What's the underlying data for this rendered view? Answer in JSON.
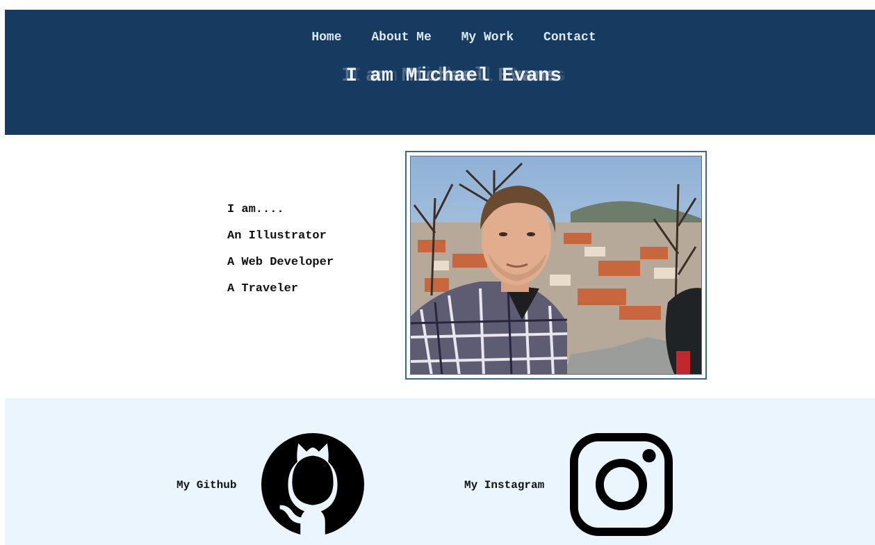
{
  "nav": {
    "items": [
      {
        "label": "Home"
      },
      {
        "label": "About Me"
      },
      {
        "label": "My Work"
      },
      {
        "label": "Contact"
      }
    ]
  },
  "hero": {
    "title": "I am Michael Evans"
  },
  "intro": {
    "roles": [
      "I am....",
      "An Illustrator",
      "A Web Developer",
      "A Traveler"
    ]
  },
  "photo": {
    "subject": "selfie-portrait-over-city"
  },
  "social": {
    "github_label": "My Github",
    "instagram_label": "My Instagram",
    "github_icon": "github-icon",
    "instagram_icon": "instagram-icon"
  },
  "colors": {
    "header_bg": "#173a60",
    "nav_text": "#dde8f5",
    "footer_bg": "#eaf5fe",
    "frame_border": "#3f6587"
  }
}
